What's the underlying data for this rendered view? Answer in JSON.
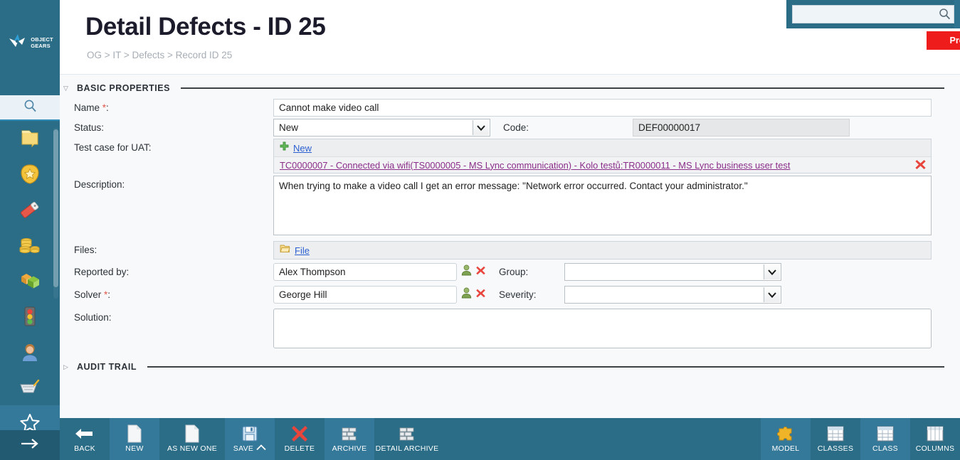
{
  "brand": {
    "name_line1": "OBJECT",
    "name_line2": "GEARS",
    "logo_icon": "object-gears-logo"
  },
  "header": {
    "title": "Detail Defects - ID 25",
    "breadcrumb": "OG > IT > Defects > Record ID 25",
    "env_badge": "Production",
    "search_value": "",
    "search_placeholder": "",
    "search_icon": "search-icon",
    "help_icon": "help-circle-icon",
    "user_icon": "user-avatar-icon"
  },
  "sidebar": {
    "search_icon": "search-icon",
    "items": [
      {
        "icon": "folder-icon",
        "name": "sidebar-item-folder",
        "active": false
      },
      {
        "icon": "badge-star-icon",
        "name": "sidebar-item-badge",
        "active": false
      },
      {
        "icon": "tag-label-icon",
        "name": "sidebar-item-tag",
        "active": false
      },
      {
        "icon": "coins-icon",
        "name": "sidebar-item-coins",
        "active": false
      },
      {
        "icon": "boxes-icon",
        "name": "sidebar-item-boxes",
        "active": false
      },
      {
        "icon": "traffic-light-icon",
        "name": "sidebar-item-traffic-light",
        "active": false
      },
      {
        "icon": "person-icon",
        "name": "sidebar-item-person",
        "active": false
      },
      {
        "icon": "basket-icon",
        "name": "sidebar-item-basket",
        "active": false
      },
      {
        "icon": "star-outline-icon",
        "name": "sidebar-item-favorites",
        "active": true
      }
    ],
    "expand_icon": "arrow-right-icon"
  },
  "sections": {
    "basic": {
      "title": "BASIC PROPERTIES",
      "expanded": true,
      "caret": "▽"
    },
    "audit": {
      "title": "AUDIT TRAIL",
      "expanded": false,
      "caret": "▷"
    }
  },
  "form": {
    "name": {
      "label": "Name",
      "required": true,
      "value": "Cannot make video call"
    },
    "status": {
      "label": "Status",
      "required": false,
      "value": "New"
    },
    "code": {
      "label": "Code",
      "required": false,
      "value": "DEF00000017"
    },
    "test_case": {
      "label": "Test case for UAT",
      "required": false,
      "add_label": "New",
      "add_icon": "plus-icon",
      "remove_icon": "remove-x-icon",
      "items": [
        "TC0000007 - Connected via wifi(TS0000005 - MS Lync communication) - Kolo testů:TR0000011 - MS Lync business user test"
      ]
    },
    "description": {
      "label": "Description",
      "required": false,
      "value": "When trying to make a video call I get an error message: \"Network error occurred. Contact your administrator.\""
    },
    "files": {
      "label": "Files",
      "required": false,
      "add_label": "File",
      "folder_icon": "folder-open-icon"
    },
    "reported_by": {
      "label": "Reported by",
      "required": false,
      "value": "Alex Thompson",
      "pick_icon": "pick-user-icon",
      "clear_icon": "clear-x-icon"
    },
    "group": {
      "label": "Group",
      "required": false,
      "value": ""
    },
    "solver": {
      "label": "Solver",
      "required": true,
      "value": "George Hill",
      "pick_icon": "pick-user-icon",
      "clear_icon": "clear-x-icon"
    },
    "severity": {
      "label": "Severity",
      "required": false,
      "value": ""
    },
    "solution": {
      "label": "Solution",
      "required": false,
      "value": ""
    }
  },
  "toolbar": {
    "left": [
      {
        "label": "BACK",
        "icon": "back-arrow-icon",
        "name": "toolbar-back-button",
        "alt": false,
        "wide": false,
        "caret": false
      },
      {
        "label": "NEW",
        "icon": "new-document-icon",
        "name": "toolbar-new-button",
        "alt": true,
        "wide": false,
        "caret": false
      },
      {
        "label": "AS NEW ONE",
        "icon": "copy-document-icon",
        "name": "toolbar-as-new-one-button",
        "alt": false,
        "wide": true,
        "caret": false
      },
      {
        "label": "SAVE",
        "icon": "save-floppy-icon",
        "name": "toolbar-save-button",
        "alt": true,
        "wide": false,
        "caret": true
      },
      {
        "label": "DELETE",
        "icon": "delete-x-icon",
        "name": "toolbar-delete-button",
        "alt": false,
        "wide": false,
        "caret": false
      },
      {
        "label": "ARCHIVE",
        "icon": "archive-icon",
        "name": "toolbar-archive-button",
        "alt": true,
        "wide": false,
        "caret": false
      },
      {
        "label": "DETAIL ARCHIVE",
        "icon": "detail-archive-icon",
        "name": "toolbar-detail-archive-button",
        "alt": false,
        "wide": true,
        "caret": false
      }
    ],
    "right": [
      {
        "label": "MODEL",
        "icon": "puzzle-piece-icon",
        "name": "toolbar-model-button",
        "alt": true
      },
      {
        "label": "CLASSES",
        "icon": "table-grid-icon",
        "name": "toolbar-classes-button",
        "alt": false
      },
      {
        "label": "CLASS",
        "icon": "table-grid-icon",
        "name": "toolbar-class-button",
        "alt": true
      },
      {
        "label": "COLUMNS",
        "icon": "columns-grid-icon",
        "name": "toolbar-columns-button",
        "alt": false
      }
    ]
  },
  "colors": {
    "brand_teal": "#2b6d87",
    "toolbar_highlight": "#35799a",
    "production_red": "#ef1c1c",
    "link_blue": "#2b5fd1",
    "link_visited": "#8a2e8a",
    "required_red": "#e2574c",
    "form_bg": "#f7f9fb"
  }
}
